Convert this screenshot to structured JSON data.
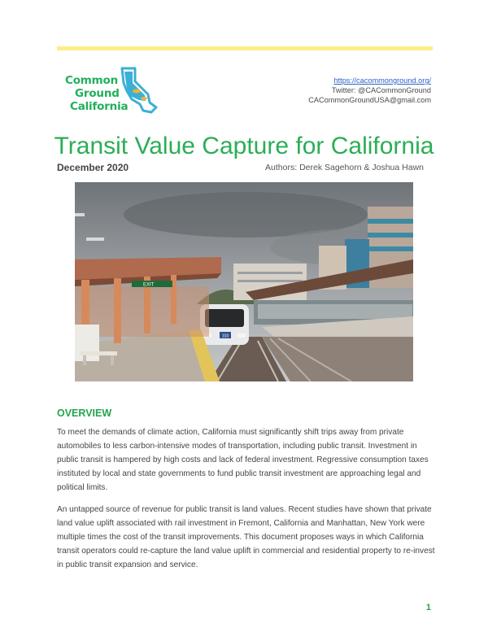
{
  "logo": {
    "line1": "Common",
    "line2": "Ground",
    "line3": "California"
  },
  "contact": {
    "url": "https://cacommonground.org/",
    "twitter": "Twitter: @CACommonGround",
    "email": "CACommonGroundUSA@gmail.com"
  },
  "title": "Transit Value Capture for California",
  "date": "December 2020",
  "authors": "Authors: Derek Sagehorn & Joshua Hawn",
  "photo": {
    "exit_sign": "EXIT",
    "train_number": "103"
  },
  "section": {
    "heading": "OVERVIEW",
    "paragraphs": [
      "To meet the demands of climate action, California must significantly shift trips away from private automobiles to less carbon-intensive modes of transportation, including public transit. Investment in public transit is hampered by high costs and lack of federal investment. Regressive consumption taxes instituted by local and state governments to fund public transit investment are approaching legal and political limits.",
      "An untapped source of revenue for public transit is land values. Recent studies have shown that private land value uplift associated with rail investment in Fremont, California and Manhattan, New York were multiple times the cost of the transit improvements. This document proposes ways in which California transit operators could re-capture the land value uplift in commercial and residential property to re-invest in public transit expansion and service."
    ]
  },
  "page_number": "1",
  "colors": {
    "green": "#23a54f",
    "accent_bar": "#fbee87",
    "link": "#2a62c9"
  }
}
